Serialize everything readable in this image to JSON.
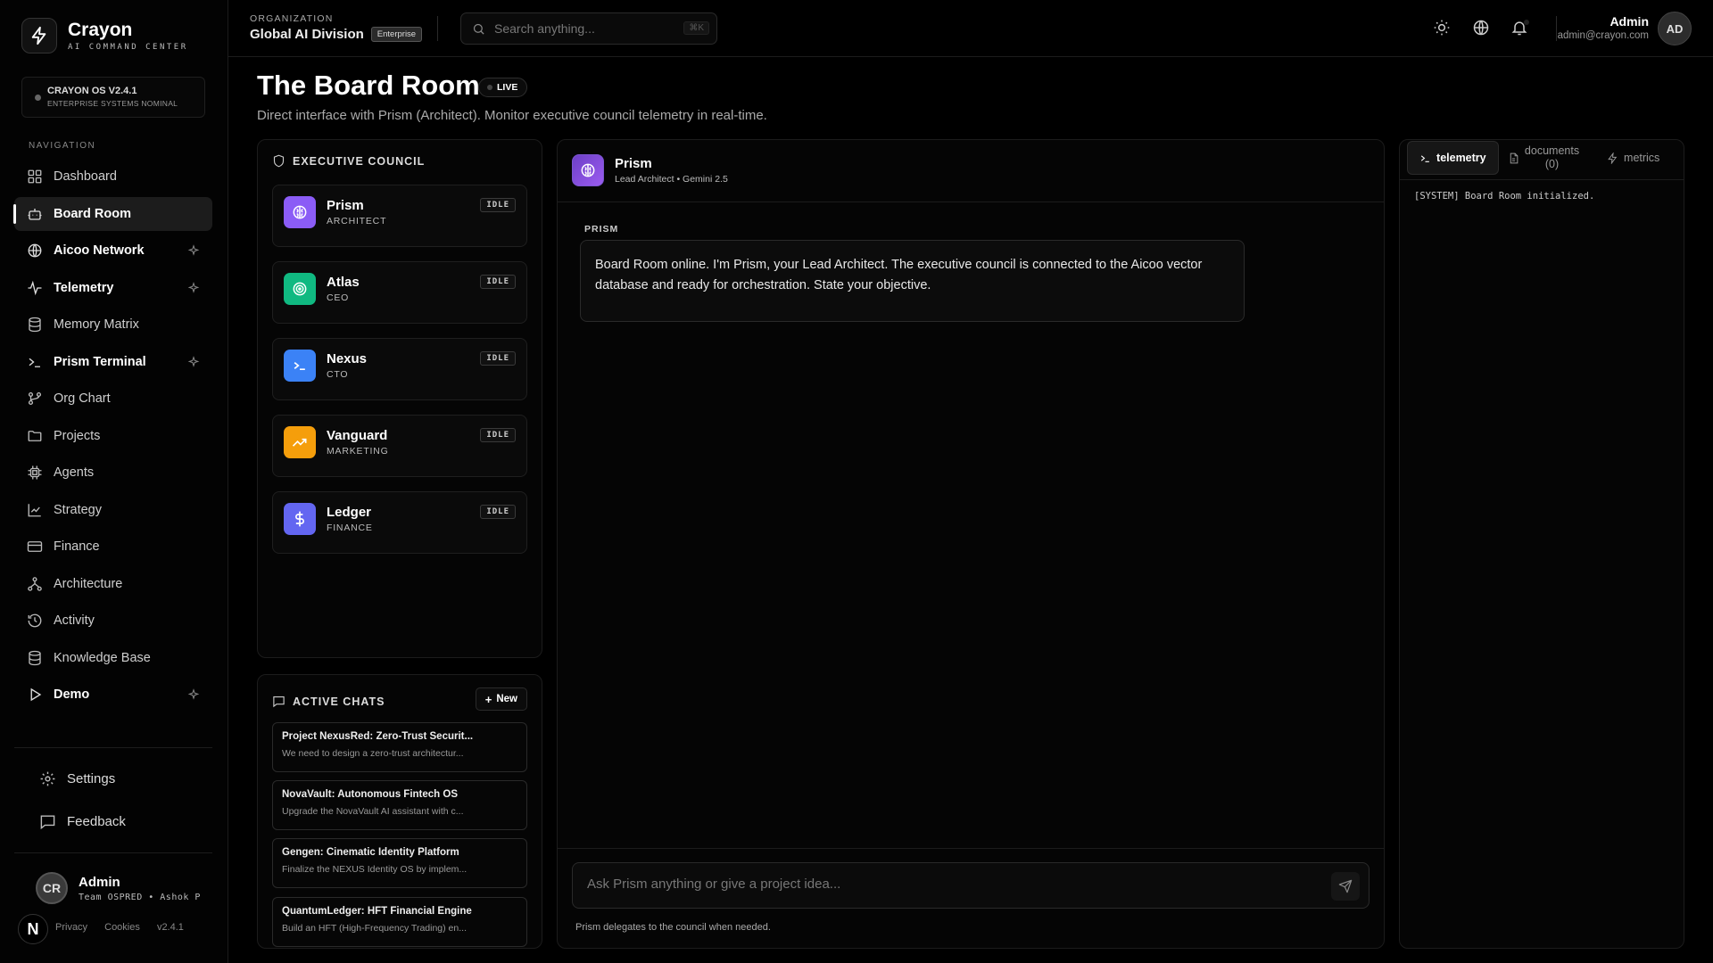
{
  "brand": {
    "name": "Crayon",
    "subtitle": "AI COMMAND CENTER"
  },
  "os_status": {
    "title": "CRAYON OS V2.4.1",
    "subtitle": "ENTERPRISE SYSTEMS NOMINAL"
  },
  "nav": {
    "label": "NAVIGATION",
    "items": [
      {
        "label": "Dashboard"
      },
      {
        "label": "Board Room"
      },
      {
        "label": "Aicoo Network"
      },
      {
        "label": "Telemetry"
      },
      {
        "label": "Memory Matrix"
      },
      {
        "label": "Prism Terminal"
      },
      {
        "label": "Org Chart"
      },
      {
        "label": "Projects"
      },
      {
        "label": "Agents"
      },
      {
        "label": "Strategy"
      },
      {
        "label": "Finance"
      },
      {
        "label": "Architecture"
      },
      {
        "label": "Activity"
      },
      {
        "label": "Knowledge Base"
      },
      {
        "label": "Demo"
      }
    ]
  },
  "sidebar_footer": {
    "settings": "Settings",
    "feedback": "Feedback",
    "user_initials": "CR",
    "user_name": "Admin",
    "user_team": "Team OSPRED • Ashok P",
    "n_logo": "N",
    "links": [
      "Privacy",
      "Cookies",
      "v2.4.1"
    ]
  },
  "header": {
    "org_label": "ORGANIZATION",
    "org_name": "Global AI Division",
    "org_badge": "Enterprise",
    "search_placeholder": "Search anything...",
    "search_shortcut": "⌘K",
    "admin_name": "Admin",
    "admin_email": "admin@crayon.com",
    "admin_initials": "AD"
  },
  "page": {
    "title": "The Board Room",
    "live": "LIVE",
    "subtitle": "Direct interface with Prism (Architect). Monitor executive council telemetry in real-time."
  },
  "council": {
    "heading": "EXECUTIVE COUNCIL",
    "agents": [
      {
        "name": "Prism",
        "role": "ARCHITECT",
        "status": "IDLE",
        "color": "#8b5cf6"
      },
      {
        "name": "Atlas",
        "role": "CEO",
        "status": "IDLE",
        "color": "#10b981"
      },
      {
        "name": "Nexus",
        "role": "CTO",
        "status": "IDLE",
        "color": "#3b82f6"
      },
      {
        "name": "Vanguard",
        "role": "MARKETING",
        "status": "IDLE",
        "color": "#f59e0b"
      },
      {
        "name": "Ledger",
        "role": "FINANCE",
        "status": "IDLE",
        "color": "#6366f1"
      }
    ]
  },
  "chats": {
    "heading": "ACTIVE CHATS",
    "new_label": "New",
    "items": [
      {
        "title": "Project NexusRed: Zero-Trust Securit...",
        "preview": "We need to design a zero-trust architectur..."
      },
      {
        "title": "NovaVault: Autonomous Fintech OS",
        "preview": "Upgrade the NovaVault AI assistant with c..."
      },
      {
        "title": "Gengen: Cinematic Identity Platform",
        "preview": "Finalize the NEXUS Identity OS by implem..."
      },
      {
        "title": "QuantumLedger: HFT Financial Engine",
        "preview": "Build an HFT (High-Frequency Trading) en..."
      }
    ]
  },
  "conversation": {
    "agent_name": "Prism",
    "agent_sub": "Lead Architect • Gemini 2.5",
    "messages": [
      {
        "sender": "PRISM",
        "text": "Board Room online. I'm Prism, your Lead Architect. The executive council is connected to the Aicoo vector database and ready for orchestration. State your objective."
      }
    ],
    "input_placeholder": "Ask Prism anything or give a project idea...",
    "note": "Prism delegates to the council when needed."
  },
  "side_panel": {
    "tabs": [
      {
        "label": "telemetry",
        "icon": "terminal-icon"
      },
      {
        "label": "documents (0)",
        "icon": "document-icon"
      },
      {
        "label": "metrics",
        "icon": "bolt-icon"
      }
    ],
    "log": [
      "[SYSTEM] Board Room initialized."
    ]
  }
}
